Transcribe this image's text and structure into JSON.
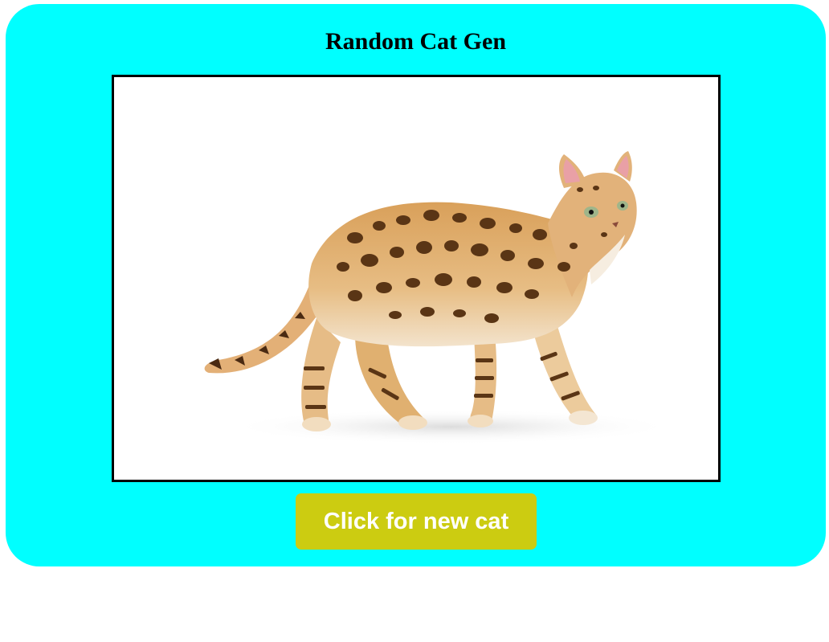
{
  "app": {
    "title": "Random Cat Gen"
  },
  "image": {
    "icon": "cat-photo",
    "alt": ""
  },
  "button": {
    "label": "Click for new cat"
  },
  "colors": {
    "background": "#00ffff",
    "button": "#cccc11",
    "button_text": "#ffffff"
  }
}
